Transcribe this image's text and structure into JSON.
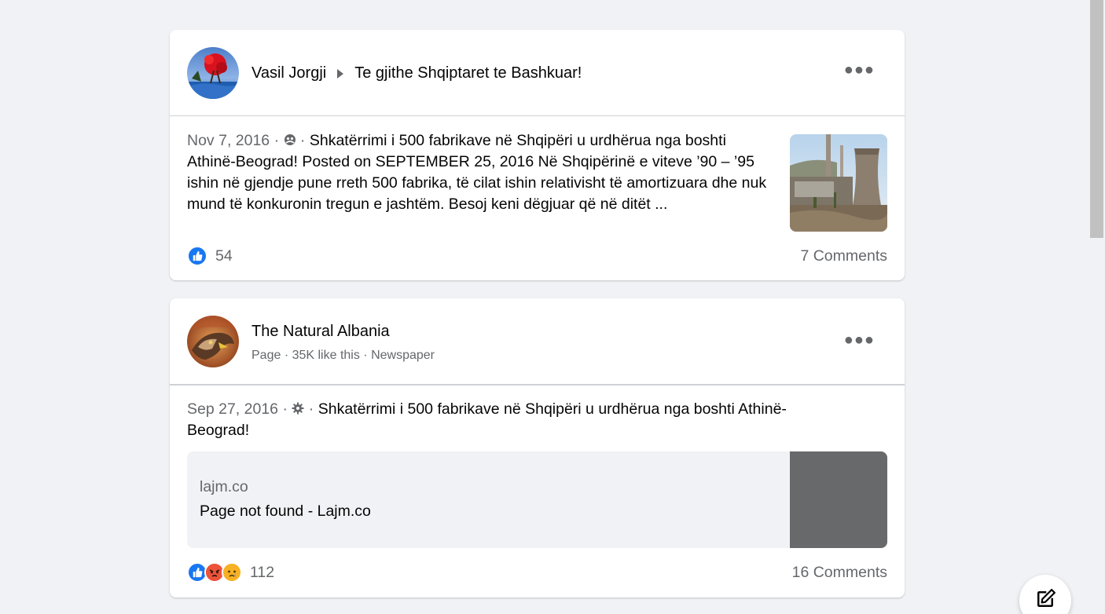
{
  "posts": [
    {
      "author": "Vasil Jorgji",
      "group": "Te gjithe Shqiptaret te Bashkuar!",
      "date": "Nov 7, 2016",
      "separator": "·",
      "text": "Shkatërrimi i 500 fabrikave në Shqipëri u urdhërua nga boshti Athinë-Beograd! Posted on SEPTEMBER 25, 2016 Në Shqipërinë e viteve ’90 – ’95 ishin në gjendje pune rreth 500 fabrika, të cilat ishin relativisht të amortizuara dhe nuk mund të konkuronin tregun e jashtëm. Besoj keni dëgjuar që në ditët ...",
      "reaction_count": "54",
      "comments": "7 Comments",
      "audience_icon": "group-audience-icon"
    },
    {
      "author": "The Natural Albania",
      "subline": "Page · 35K like this · Newspaper",
      "date": "Sep 27, 2016",
      "separator": "·",
      "text": "Shkatërrimi i 500 fabrikave në Shqipëri u urdhërua nga boshti Athinë-Beograd!",
      "link_domain": "lajm.co",
      "link_title": "Page not found - Lajm.co",
      "reaction_count": "112",
      "comments": "16 Comments",
      "audience_icon": "gear-icon"
    }
  ],
  "icons": {
    "more": "more-options-icon",
    "like": "like-icon",
    "angry": "angry-icon",
    "sad": "sad-icon",
    "compose": "compose-icon"
  },
  "colors": {
    "background": "#f0f2f5",
    "like_blue": "#1877f2",
    "secondary_text": "#65676b"
  }
}
